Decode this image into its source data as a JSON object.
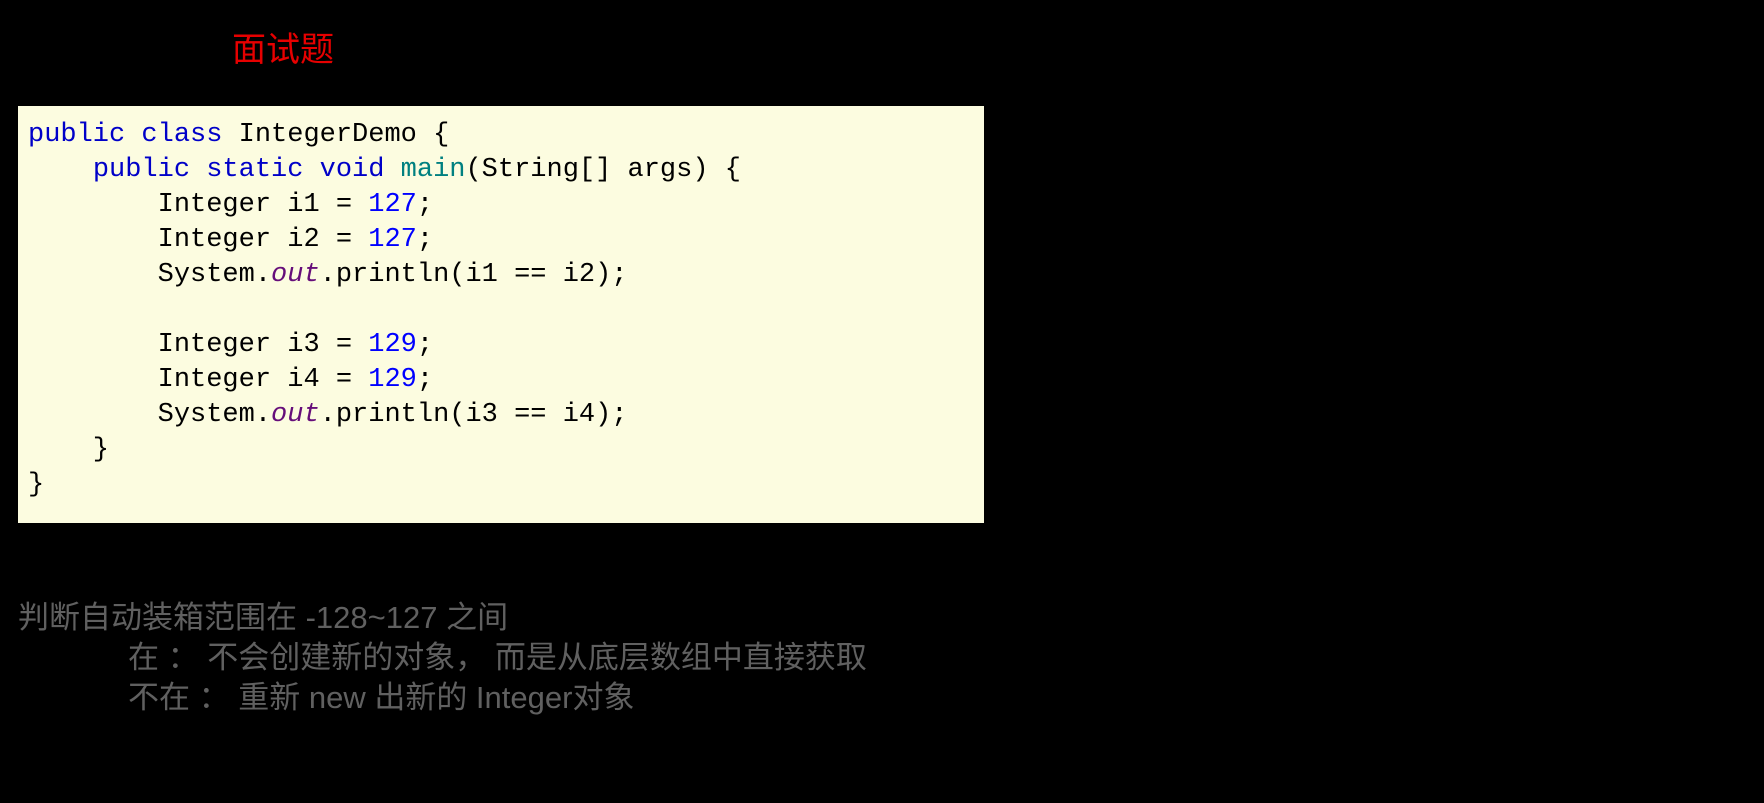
{
  "title": "面试题",
  "code": {
    "line1": {
      "kw1": "public",
      "kw2": "class",
      "rest": " IntegerDemo {"
    },
    "line2": {
      "indent": "    ",
      "kw1": "public",
      "kw2": "static",
      "kw3": "void",
      "fn": "main",
      "rest": "(String[] args) {"
    },
    "line3": {
      "indent": "        ",
      "text1": "Integer i1 = ",
      "num": "127",
      "text2": ";"
    },
    "line4": {
      "indent": "        ",
      "text1": "Integer i2 = ",
      "num": "127",
      "text2": ";"
    },
    "line5": {
      "indent": "        ",
      "text1": "System.",
      "field": "out",
      "text2": ".println(i1 == i2);"
    },
    "line6": "",
    "line7": {
      "indent": "        ",
      "text1": "Integer i3 = ",
      "num": "129",
      "text2": ";"
    },
    "line8": {
      "indent": "        ",
      "text1": "Integer i4 = ",
      "num": "129",
      "text2": ";"
    },
    "line9": {
      "indent": "        ",
      "text1": "System.",
      "field": "out",
      "text2": ".println(i3 == i4);"
    },
    "line10": "    }",
    "line11": "}"
  },
  "explanation": {
    "line1": "判断自动装箱范围在 -128~127 之间",
    "line2": "在 ： 不会创建新的对象， 而是从底层数组中直接获取",
    "line3": "不在 ： 重新 new 出新的 Integer对象"
  }
}
